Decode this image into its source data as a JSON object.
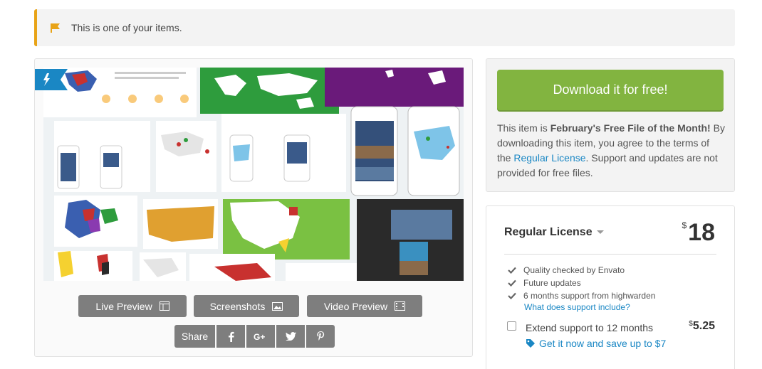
{
  "notice": {
    "text": "This is one of your items."
  },
  "preview": {
    "buttons": {
      "live_preview": "Live Preview",
      "screenshots": "Screenshots",
      "video_preview": "Video Preview"
    },
    "share": {
      "label": "Share"
    }
  },
  "free_file": {
    "download_label": "Download it for free!",
    "text_prefix": "This item is ",
    "text_bold": "February's Free File of the Month!",
    "text_middle": " By downloading this item, you agree to the terms of the ",
    "license_link": "Regular License",
    "text_suffix": ". Support and updates are not provided for free files."
  },
  "license": {
    "name": "Regular License",
    "currency": "$",
    "price": "18",
    "features": [
      "Quality checked by Envato",
      "Future updates",
      "6 months support from highwarden"
    ],
    "support_link": "What does support include?",
    "extend_label": "Extend support to 12 months",
    "extend_currency": "$",
    "extend_price": "5.25",
    "save_link": "Get it now and save up to $7"
  },
  "colors": {
    "download_green": "#82b440",
    "link_blue": "#1a87c4",
    "notice_accent": "#e8a317",
    "button_gray": "#7e7e7e"
  }
}
